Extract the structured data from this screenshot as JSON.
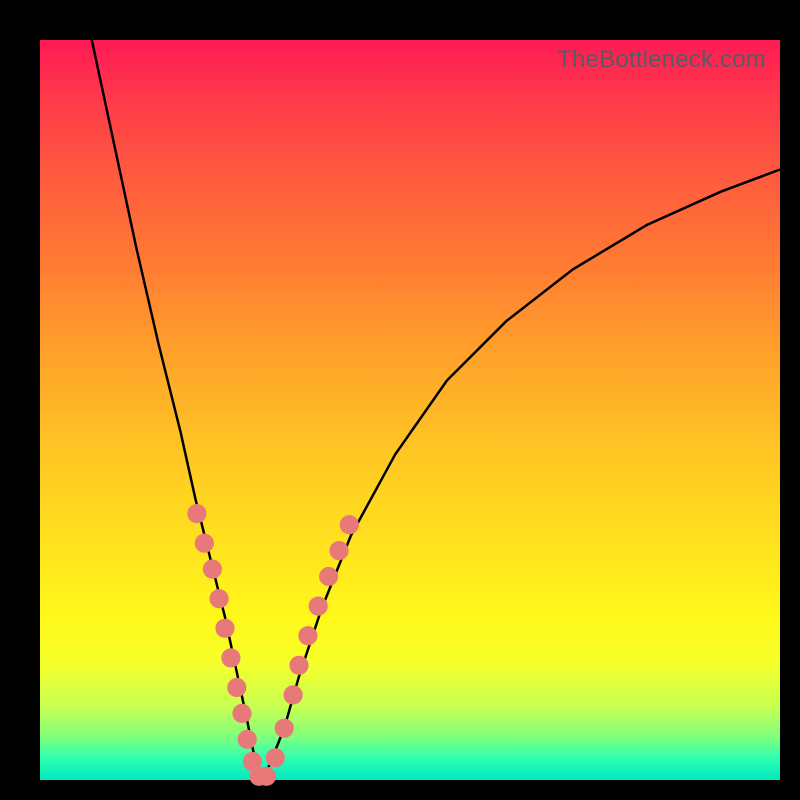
{
  "watermark": "TheBottleneck.com",
  "chart_data": {
    "type": "line",
    "title": "",
    "xlabel": "",
    "ylabel": "",
    "xlim": [
      0,
      100
    ],
    "ylim": [
      0,
      100
    ],
    "background_gradient": {
      "top": "#ff1a55",
      "upper_mid": "#ffa02a",
      "mid": "#ffe21e",
      "lower_mid": "#c8ff50",
      "bottom": "#00e9c0"
    },
    "series": [
      {
        "name": "bottleneck-curve",
        "color": "#000000",
        "x": [
          7,
          10,
          13,
          16,
          19,
          21,
          23,
          25,
          26.5,
          28,
          29,
          30,
          31,
          33,
          35,
          38,
          42,
          48,
          55,
          63,
          72,
          82,
          92,
          100
        ],
        "y": [
          100,
          86,
          72,
          59,
          47,
          38,
          30,
          22,
          15,
          8,
          3,
          0,
          2,
          7,
          14,
          23,
          33,
          44,
          54,
          62,
          69,
          75,
          79.5,
          82.5
        ]
      }
    ],
    "markers": {
      "name": "highlight-points",
      "color": "#e77a78",
      "radius_pct": 1.3,
      "x": [
        21.2,
        22.2,
        23.3,
        24.2,
        25.0,
        25.8,
        26.6,
        27.3,
        28.0,
        28.7,
        29.6,
        30.6,
        31.8,
        33.0,
        34.2,
        35.0,
        36.2,
        37.6,
        39.0,
        40.4,
        41.8
      ],
      "y": [
        36.0,
        32.0,
        28.5,
        24.5,
        20.5,
        16.5,
        12.5,
        9.0,
        5.5,
        2.5,
        0.5,
        0.5,
        3.0,
        7.0,
        11.5,
        15.5,
        19.5,
        23.5,
        27.5,
        31.0,
        34.5
      ]
    }
  }
}
